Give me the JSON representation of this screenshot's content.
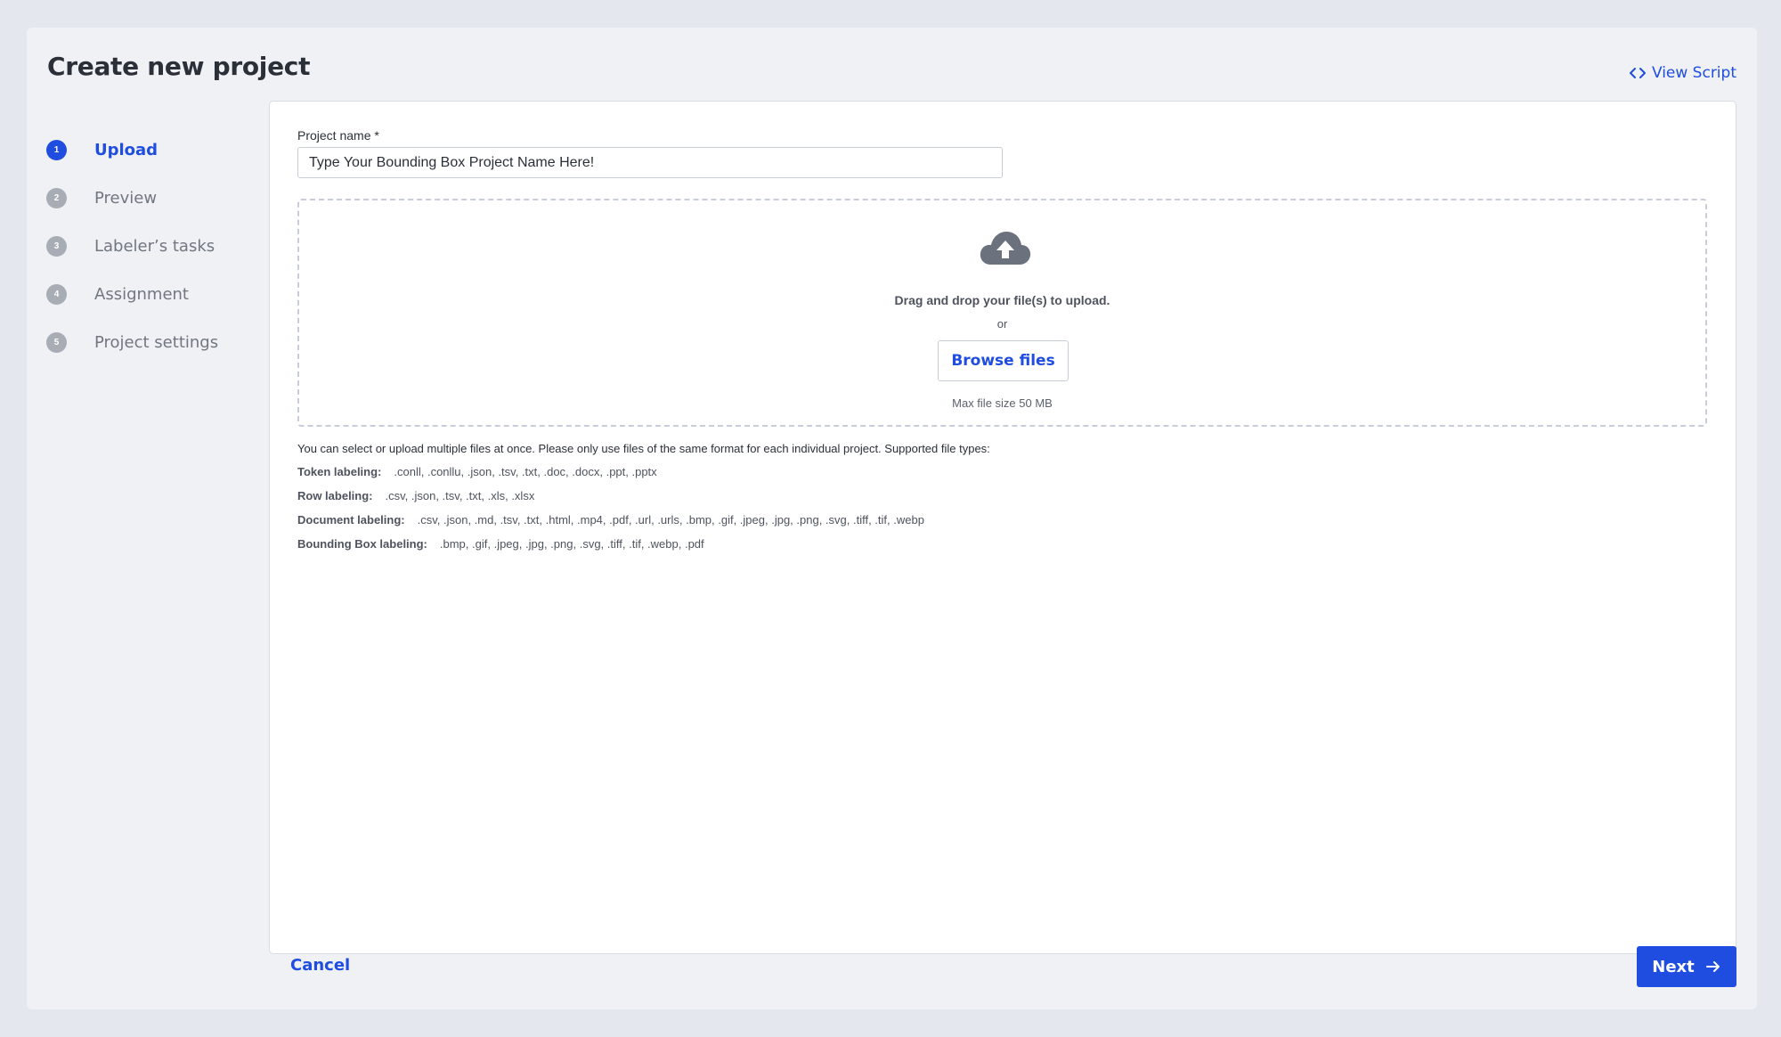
{
  "header": {
    "title": "Create new project",
    "view_script": "View Script"
  },
  "steps": [
    {
      "num": "1",
      "label": "Upload",
      "active": true
    },
    {
      "num": "2",
      "label": "Preview",
      "active": false
    },
    {
      "num": "3",
      "label": "Labeler’s tasks",
      "active": false
    },
    {
      "num": "4",
      "label": "Assignment",
      "active": false
    },
    {
      "num": "5",
      "label": "Project settings",
      "active": false
    }
  ],
  "form": {
    "project_name_label": "Project name *",
    "project_name_value": "Type Your Bounding Box Project Name Here!"
  },
  "dropzone": {
    "main_text": "Drag and drop your file(s) to upload.",
    "or_text": "or",
    "browse_label": "Browse files",
    "max_size": "Max file size 50 MB"
  },
  "info": {
    "text": "You can select or upload multiple files at once. Please only use files of the same format for each individual project. Supported file types:",
    "types": [
      {
        "name": "Token labeling:",
        "exts": ".conll, .conllu, .json, .tsv, .txt, .doc, .docx, .ppt, .pptx"
      },
      {
        "name": "Row labeling:",
        "exts": ".csv, .json, .tsv, .txt, .xls, .xlsx"
      },
      {
        "name": "Document labeling:",
        "exts": ".csv, .json, .md, .tsv, .txt, .html, .mp4, .pdf, .url, .urls, .bmp, .gif, .jpeg, .jpg, .png, .svg, .tiff, .tif, .webp"
      },
      {
        "name": "Bounding Box labeling:",
        "exts": ".bmp, .gif, .jpeg, .jpg, .png, .svg, .tiff, .tif, .webp, .pdf"
      }
    ]
  },
  "footer": {
    "cancel_label": "Cancel",
    "next_label": "Next"
  },
  "colors": {
    "accent": "#1f4de0",
    "background": "#e4e7ee",
    "step_inactive": "#a8acb5"
  }
}
